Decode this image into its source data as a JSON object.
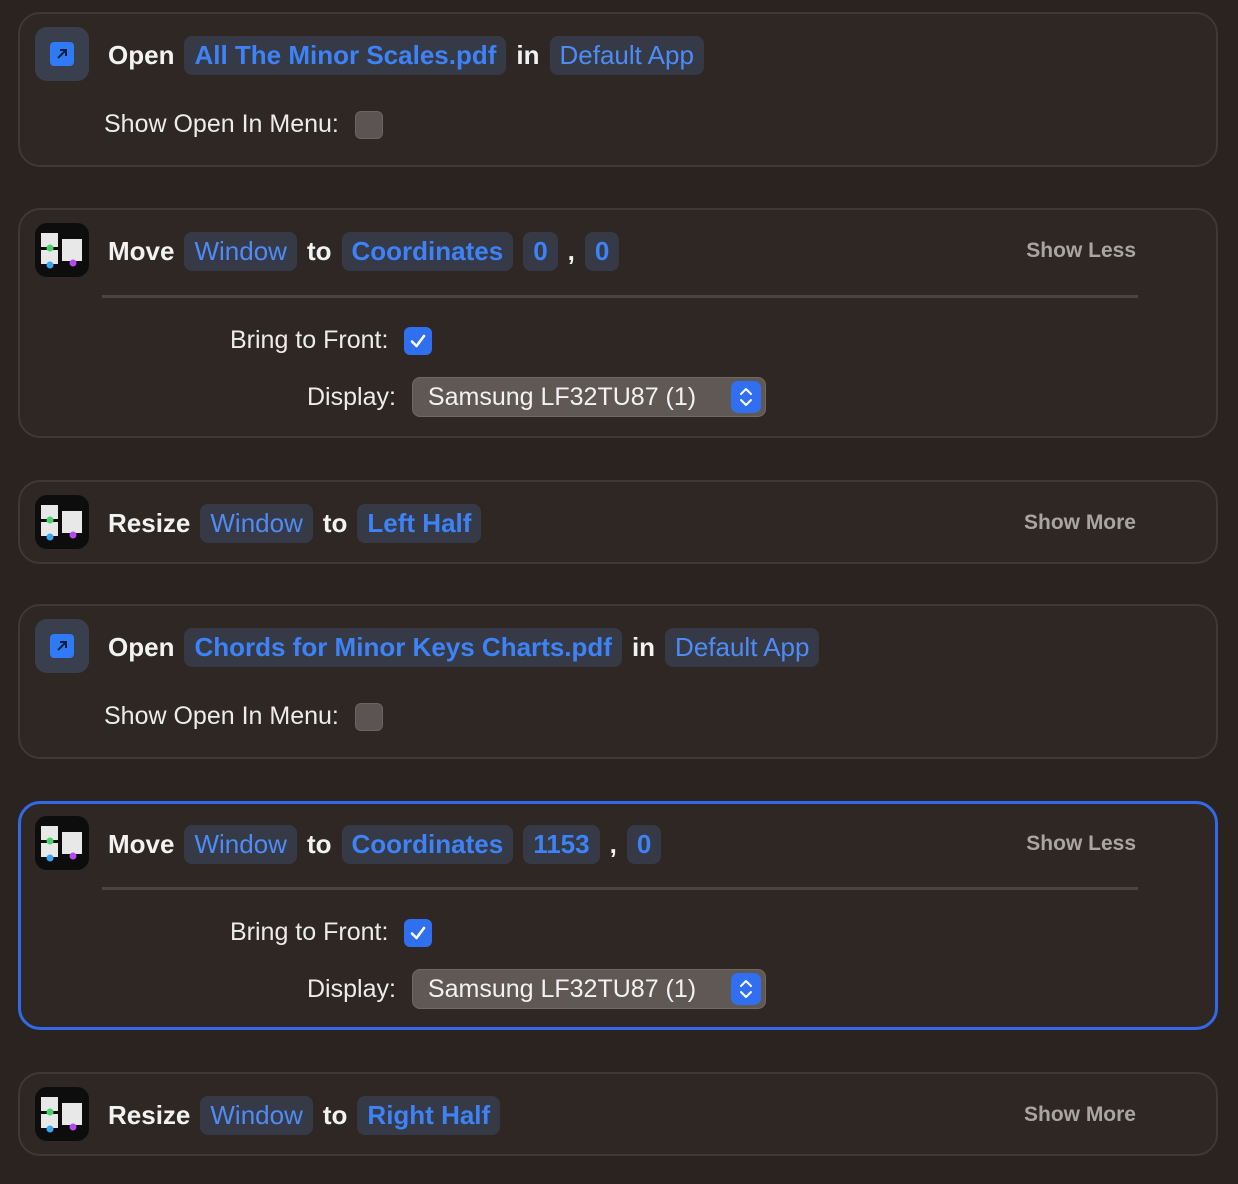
{
  "actions": [
    {
      "verb": "Open",
      "file": "All The Minor Scales.pdf",
      "conj": "in",
      "app": "Default App",
      "option_label": "Show Open In Menu:"
    },
    {
      "verb": "Move",
      "target": "Window",
      "conj": "to",
      "mode": "Coordinates",
      "x": "0",
      "sep": ",",
      "y": "0",
      "toggle": "Show Less",
      "bring_label": "Bring to Front:",
      "display_label": "Display:",
      "display_value": "Samsung LF32TU87 (1)"
    },
    {
      "verb": "Resize",
      "target": "Window",
      "conj": "to",
      "size": "Left Half",
      "toggle": "Show More"
    },
    {
      "verb": "Open",
      "file": "Chords for Minor Keys Charts.pdf",
      "conj": "in",
      "app": "Default App",
      "option_label": "Show Open In Menu:"
    },
    {
      "verb": "Move",
      "target": "Window",
      "conj": "to",
      "mode": "Coordinates",
      "x": "1153",
      "sep": ",",
      "y": "0",
      "toggle": "Show Less",
      "bring_label": "Bring to Front:",
      "display_label": "Display:",
      "display_value": "Samsung LF32TU87 (1)"
    },
    {
      "verb": "Resize",
      "target": "Window",
      "conj": "to",
      "size": "Right Half",
      "toggle": "Show More"
    }
  ],
  "icons": {
    "open": "open-file-arrow-icon",
    "window": "window-manager-icon",
    "checkbox_checked": "checkmark-icon",
    "stepper": "up-down-chevron-icon"
  },
  "colors": {
    "accent": "#2f6ff0",
    "token_text": "#4f8bf7",
    "card_bg": "#2e2724",
    "page_bg": "#2a2320"
  }
}
